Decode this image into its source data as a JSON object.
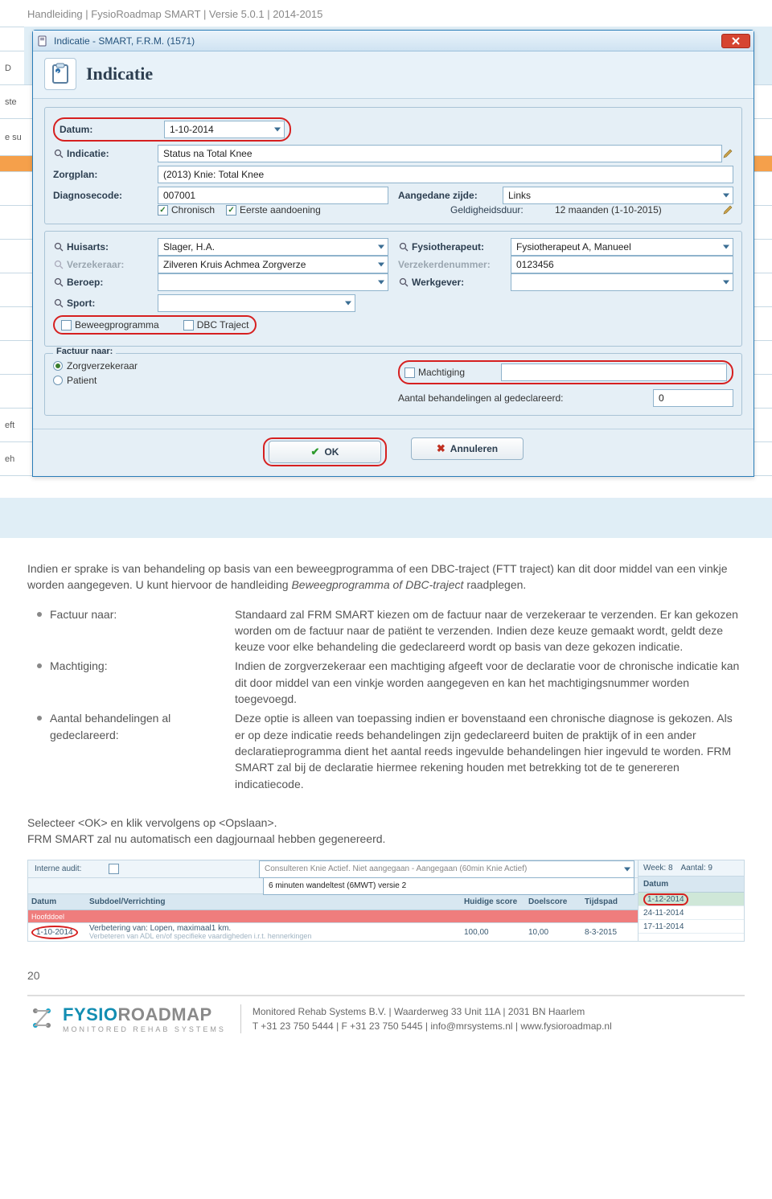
{
  "page_header": "Handleiding  |  FysioRoadmap SMART  |  Versie 5.0.1  |  2014-2015",
  "window": {
    "title": "Indicatie - SMART, F.R.M. (1571)",
    "heading": "Indicatie"
  },
  "form": {
    "labels": {
      "datum": "Datum:",
      "indicatie": "Indicatie:",
      "zorgplan": "Zorgplan:",
      "diagnosecode": "Diagnosecode:",
      "aangedane": "Aangedane zijde:",
      "chronisch": "Chronisch",
      "eerste": "Eerste aandoening",
      "geldigheid": "Geldigheidsduur:",
      "huisarts": "Huisarts:",
      "fysio": "Fysiotherapeut:",
      "verzekeraar": "Verzekeraar:",
      "verzekerdenr": "Verzekerdenummer:",
      "beroep": "Beroep:",
      "werkgever": "Werkgever:",
      "sport": "Sport:",
      "beweeg": "Beweegprogramma",
      "dbc": "DBC Traject",
      "factuurnaar": "Factuur naar:",
      "zorgverz_radio": "Zorgverzekeraar",
      "patient_radio": "Patient",
      "machtiging": "Machtiging",
      "aantal": "Aantal behandelingen al gedeclareerd:"
    },
    "values": {
      "datum": "1-10-2014",
      "indicatie": "Status na Total Knee",
      "zorgplan": "(2013) Knie: Total Knee",
      "diagnosecode": "007001",
      "aangedane": "Links",
      "geldigheid": "12 maanden (1-10-2015)",
      "huisarts": "Slager, H.A.",
      "fysio": "Fysiotherapeut A, Manueel",
      "verzekeraar": "Zilveren Kruis Achmea Zorgverze",
      "verzekerdenr": "0123456",
      "aantal": "0"
    },
    "buttons": {
      "ok": "OK",
      "annuleren": "Annuleren"
    }
  },
  "paragraph1": {
    "p1": "Indien er sprake is van behandeling op basis van een beweegprogramma of een DBC-traject (FTT traject) kan dit door middel van een vinkje worden aangegeven. U kunt hiervoor de handleiding ",
    "em": "Beweegprogramma of DBC-traject",
    "p2": " raadplegen."
  },
  "bullets": [
    {
      "label": "Factuur naar:",
      "text": "Standaard zal FRM SMART kiezen om de factuur naar de verzekeraar te verzenden. Er kan gekozen worden om de factuur naar de patiënt te verzenden. Indien deze keuze gemaakt wordt, geldt deze keuze voor elke behandeling die gedeclareerd wordt op basis van deze gekozen indicatie."
    },
    {
      "label": "Machtiging:",
      "text": "Indien de zorgverzekeraar een machtiging afgeeft voor de declaratie voor de chronische indicatie kan dit door middel van een vinkje worden aangegeven en kan het machtigingsnummer worden toegevoegd."
    },
    {
      "label": "Aantal behandelingen al gedeclareerd:",
      "text": "Deze optie is alleen van toepassing indien er bovenstaand een chronische diagnose is gekozen. Als er op deze indicatie reeds behandelingen zijn gedeclareerd buiten de praktijk of in een ander declaratieprogramma dient het aantal reeds ingevulde behandelingen hier ingevuld te worden. FRM SMART zal bij de declaratie hiermee rekening houden met betrekking tot de te genereren indicatiecode."
    }
  ],
  "paragraph2": {
    "l1": "Selecteer <OK> en klik vervolgens op <Opslaan>.",
    "l2": "FRM SMART zal nu automatisch een dagjournaal hebben gegenereerd."
  },
  "strip": {
    "audit_label": "Interne audit:",
    "top_combo": [
      "Consulteren Knie Actief. Niet aangegaan - Aangegaan (60min Knie Actief)",
      "6 minuten wandeltest (6MWT) versie 2"
    ],
    "headers": {
      "datum": "Datum",
      "subdoel": "Subdoel/Verrichting",
      "huidige": "Huidige score",
      "doel": "Doelscore",
      "tijdspad": "Tijdspad"
    },
    "band": "Hoofddoel",
    "row_date": "1-10-2014",
    "row_text": "Verbetering van: Lopen, maximaal1 km.",
    "row_sub": "Verbeteren van ADL en/of specifieke vaardigheden i.r.t. hennerkingen",
    "row_vals": [
      "100,00",
      "10,00",
      "8-3-2015"
    ],
    "side": {
      "week": "Week:   8",
      "aantal": "Aantal:   9",
      "date_hdr": "Datum",
      "dates": [
        "1-12-2014",
        "24-11-2014",
        "17-11-2014"
      ]
    }
  },
  "page_num": "20",
  "footer": {
    "logo_a": "FYSIO",
    "logo_b": "ROADMAP",
    "logo_sub": "MONITORED REHAB SYSTEMS",
    "line1": "Monitored Rehab Systems B.V.  |  Waarderweg 33  Unit 11A  |  2031 BN Haarlem",
    "line2": "T  +31 23 750 5444  |  F  +31 23 750 5445  |  info@mrsystems.nl  |  www.fysioroadmap.nl"
  }
}
